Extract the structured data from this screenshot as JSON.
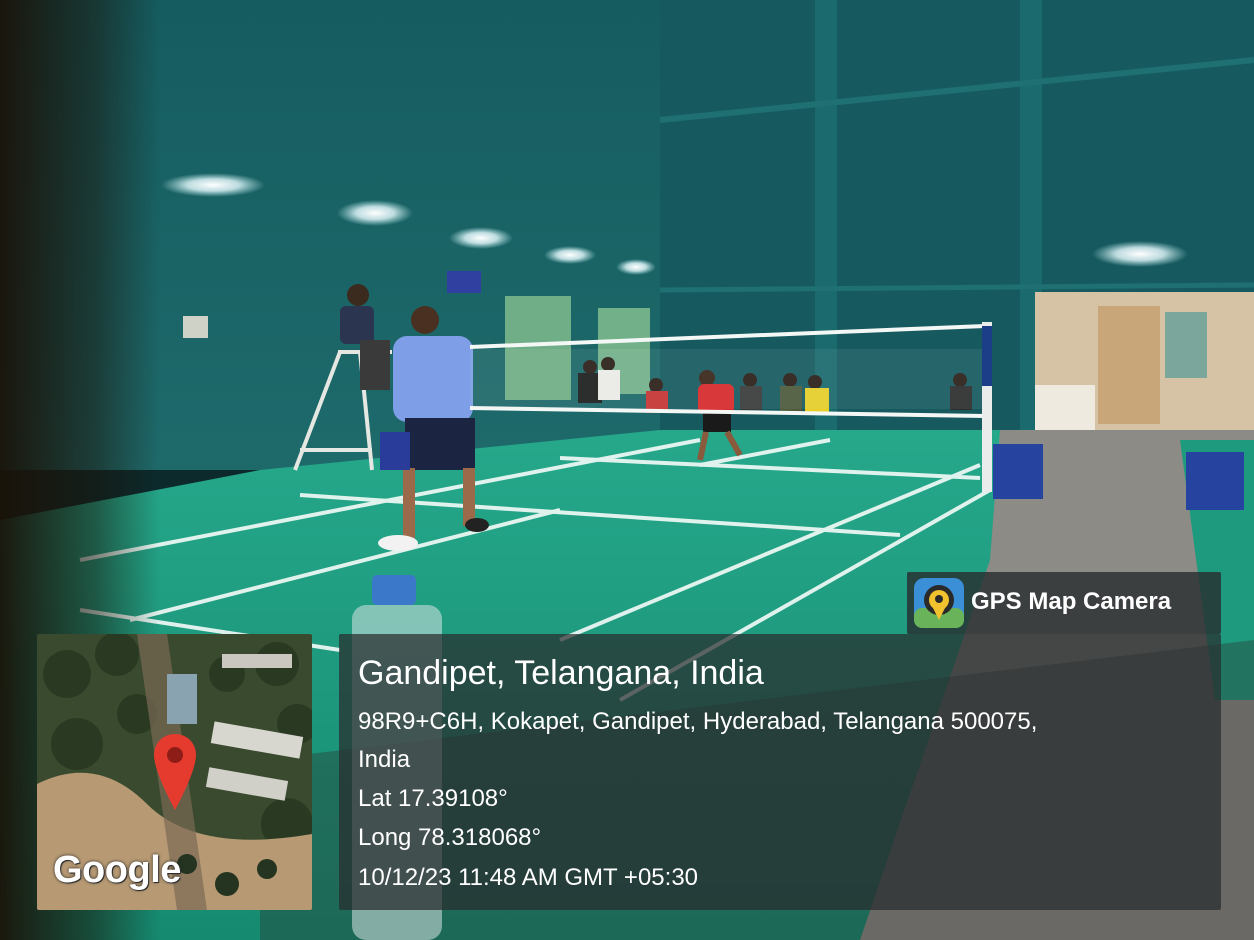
{
  "badge": {
    "label": "GPS Map Camera",
    "icon": "gps-camera-icon"
  },
  "map": {
    "logo_text": "Google",
    "marker": "location-pin-icon"
  },
  "location": {
    "title": "Gandipet, Telangana, India",
    "address_line1": "98R9+C6H, Kokapet, Gandipet, Hyderabad, Telangana 500075,",
    "address_line2": "India",
    "lat": "Lat 17.39108°",
    "long": "Long 78.318068°",
    "timestamp": "10/12/23 11:48 AM GMT +05:30"
  },
  "colors": {
    "court": "#1f9e83",
    "wall": "#1d5f63",
    "overlay": "#2c3032"
  }
}
